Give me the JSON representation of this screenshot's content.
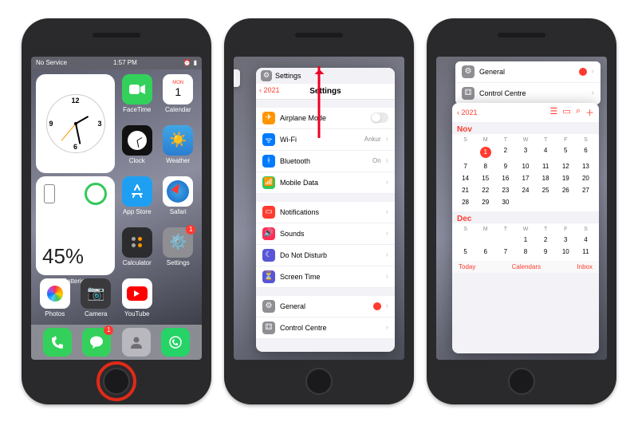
{
  "statusbar": {
    "carrier": "No Service",
    "time": "1:57 PM"
  },
  "widgets": {
    "clock_label": "Clock",
    "batteries_label": "Batteries",
    "battery_percent": "45%"
  },
  "calendar_icon": {
    "day": "MON",
    "date": "1"
  },
  "apps": {
    "facetime": "FaceTime",
    "calendar": "Calendar",
    "clock": "Clock",
    "weather": "Weather",
    "appstore": "App Store",
    "safari": "Safari",
    "calculator": "Calculator",
    "settings": "Settings",
    "photos": "Photos",
    "camera": "Camera",
    "youtube": "YouTube"
  },
  "badges": {
    "settings": "1",
    "messages": "1"
  },
  "switcher": {
    "settings_title": "Settings",
    "back": "‹ 2021",
    "header": "Settings",
    "rows": {
      "airplane": "Airplane Mode",
      "wifi": "Wi-Fi",
      "wifi_val": "Ankur",
      "bluetooth": "Bluetooth",
      "bluetooth_val": "On",
      "mobiledata": "Mobile Data",
      "notifications": "Notifications",
      "sounds": "Sounds",
      "dnd": "Do Not Disturb",
      "screentime": "Screen Time",
      "general": "General",
      "controlcentre": "Control Centre"
    },
    "general_badge": "1"
  },
  "calendar": {
    "back_year": "‹ 2021",
    "month1": "Nov",
    "month2": "Dec",
    "dow": [
      "S",
      "M",
      "T",
      "W",
      "T",
      "F",
      "S"
    ],
    "nov": [
      "",
      "1",
      "2",
      "3",
      "4",
      "5",
      "6",
      "7",
      "8",
      "9",
      "10",
      "11",
      "12",
      "13",
      "14",
      "15",
      "16",
      "17",
      "18",
      "19",
      "20",
      "21",
      "22",
      "23",
      "24",
      "25",
      "26",
      "27",
      "28",
      "29",
      "30",
      "",
      "",
      "",
      ""
    ],
    "selected": "1",
    "dec": [
      "",
      "",
      "",
      "1",
      "2",
      "3",
      "4",
      "5",
      "6",
      "7",
      "8",
      "9",
      "10",
      "11"
    ],
    "footer": {
      "today": "Today",
      "calendars": "Calendars",
      "inbox": "Inbox"
    }
  },
  "settings_top": {
    "general": "General",
    "controlcentre": "Control Centre",
    "general_badge": "1"
  },
  "colors": {
    "airplane": "#ff9500",
    "wifi": "#007aff",
    "bluetooth": "#007aff",
    "mobiledata": "#34c759",
    "notifications": "#ff3b30",
    "sounds": "#ff2d55",
    "dnd": "#5856d6",
    "screentime": "#5856d6",
    "general": "#8e8e93",
    "controlcentre": "#8e8e93"
  }
}
